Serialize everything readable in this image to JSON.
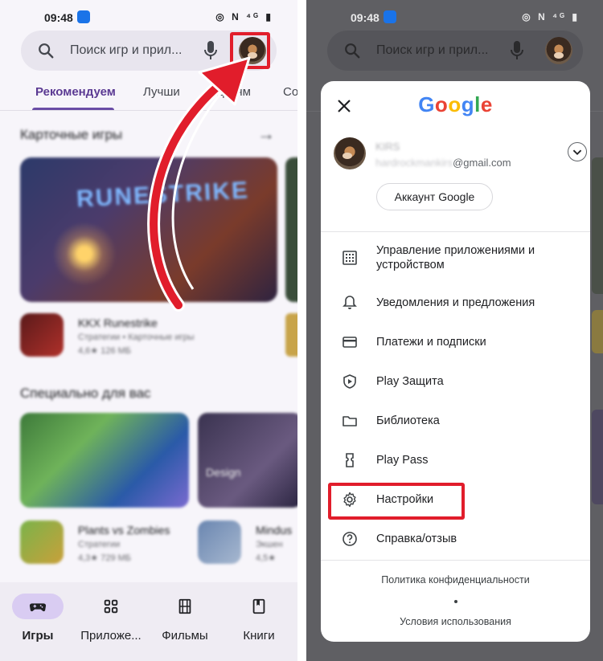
{
  "status": {
    "time": "09:48",
    "icons": "◎ N ⁴ᴳ ▮"
  },
  "search": {
    "placeholder": "Поиск игр и прил..."
  },
  "left": {
    "tabs": [
      "Рекомендуем",
      "Лучши",
      "детям",
      "Со"
    ],
    "section1": {
      "title": "Карточные игры",
      "hero_logo": "RUNESTRIKE"
    },
    "app1": {
      "name": "KKX Runestrike",
      "meta": "Стратегии • Карточные игры",
      "rating": "4,6★   126 МБ"
    },
    "section2": {
      "title": "Специально для вас"
    },
    "app2": {
      "name": "Plants vs Zombies",
      "meta": "Стратегии",
      "rating": "4,3★   729 МБ"
    },
    "app3": {
      "name": "Mindus",
      "meta": "Экшен",
      "rating": "4,5★"
    },
    "card2_text": "Design",
    "nav": [
      "Игры",
      "Приложе...",
      "Фильмы",
      "Книги"
    ]
  },
  "modal": {
    "logo_letters": [
      {
        "ch": "G",
        "color": "#4285F4"
      },
      {
        "ch": "o",
        "color": "#EA4335"
      },
      {
        "ch": "o",
        "color": "#FBBC05"
      },
      {
        "ch": "g",
        "color": "#4285F4"
      },
      {
        "ch": "l",
        "color": "#34A853"
      },
      {
        "ch": "e",
        "color": "#EA4335"
      }
    ],
    "account_name": "KIRS",
    "email_hidden": "hardrockmankirs",
    "email_domain": "@gmail.com",
    "account_button": "Аккаунт Google",
    "menu": [
      "Управление приложениями и устройством",
      "Уведомления и предложения",
      "Платежи и подписки",
      "Play Защита",
      "Библиотека",
      "Play Pass",
      "Настройки",
      "Справка/отзыв"
    ],
    "privacy": "Политика конфиденциальности",
    "terms": "Условия использования"
  },
  "colors": {
    "accent": "#6a4da6",
    "highlight": "#e11d2b"
  }
}
